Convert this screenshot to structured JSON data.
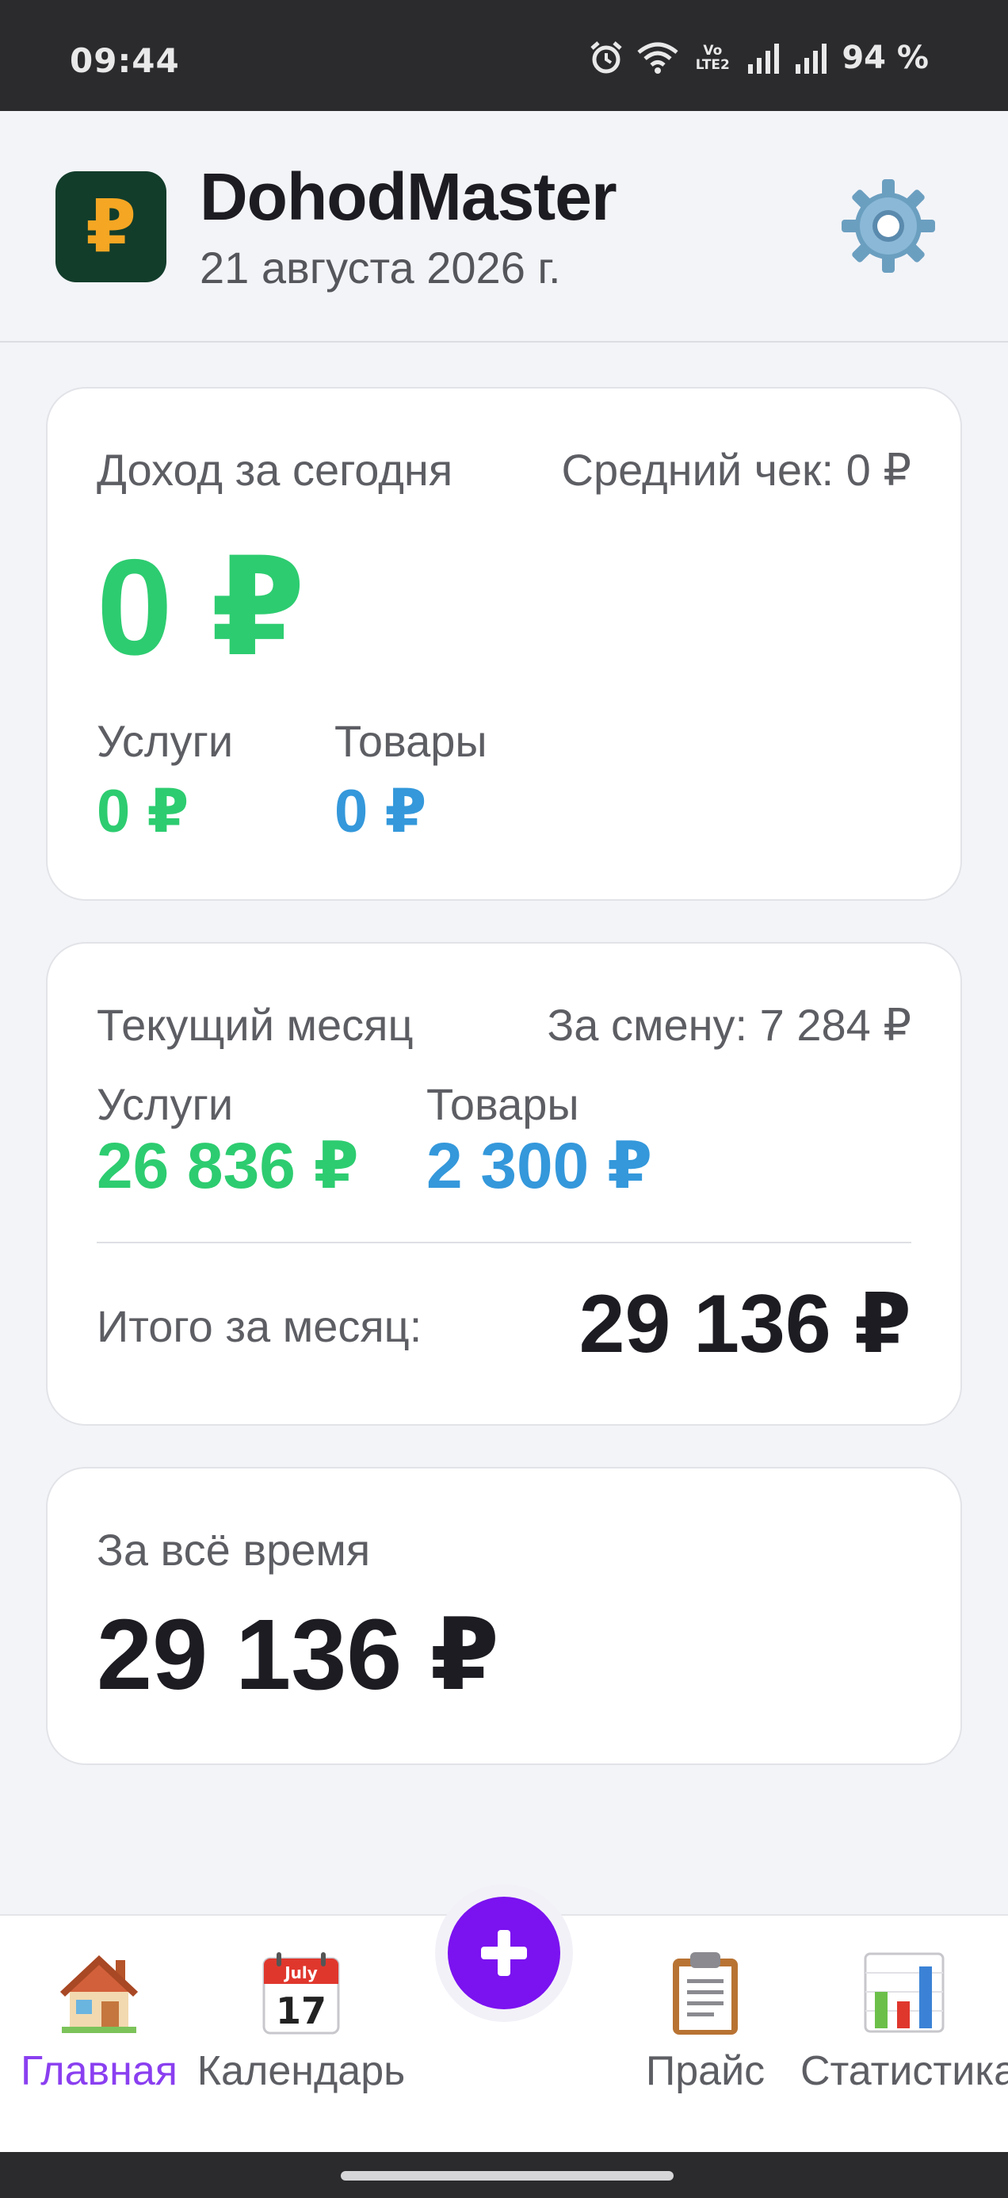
{
  "status_bar": {
    "time": "09:44",
    "battery": "94 %",
    "network_label": "Vo LTE2",
    "icons": [
      "alarm-icon",
      "wifi-icon",
      "volte-icon",
      "signal-icon",
      "signal-icon",
      "battery"
    ]
  },
  "header": {
    "logo_symbol": "₽",
    "title": "DohodMaster",
    "date": "21 августа 2026 г.",
    "settings_icon": "gear-icon"
  },
  "today": {
    "label": "Доход за сегодня",
    "avg_check": "Средний чек: 0 ₽",
    "total": "0 ₽",
    "services_label": "Услуги",
    "services_value": "0 ₽",
    "goods_label": "Товары",
    "goods_value": "0 ₽"
  },
  "month": {
    "label": "Текущий месяц",
    "per_shift": "За смену: 7 284 ₽",
    "services_label": "Услуги",
    "services_value": "26 836 ₽",
    "goods_label": "Товары",
    "goods_value": "2 300 ₽",
    "total_label": "Итого за месяц:",
    "total_value": "29 136 ₽"
  },
  "all_time": {
    "label": "За всё время",
    "value": "29 136 ₽"
  },
  "bottom_nav": {
    "items": [
      {
        "label": "Главная",
        "icon": "house-icon",
        "active": true
      },
      {
        "label": "Календарь",
        "icon": "calendar-icon",
        "active": false
      },
      {
        "label": "Прайс",
        "icon": "clipboard-icon",
        "active": false
      },
      {
        "label": "Статистика",
        "icon": "bar-chart-icon",
        "active": false
      }
    ],
    "fab_icon": "plus-icon",
    "calendar_month": "July",
    "calendar_day": "17"
  },
  "colors": {
    "accent": "#7b12f0",
    "income_green": "#2dcc70",
    "goods_blue": "#3498db",
    "active_tab": "#8a3ff0",
    "logo_bg": "#123d2b",
    "logo_symbol": "#f5a623"
  }
}
